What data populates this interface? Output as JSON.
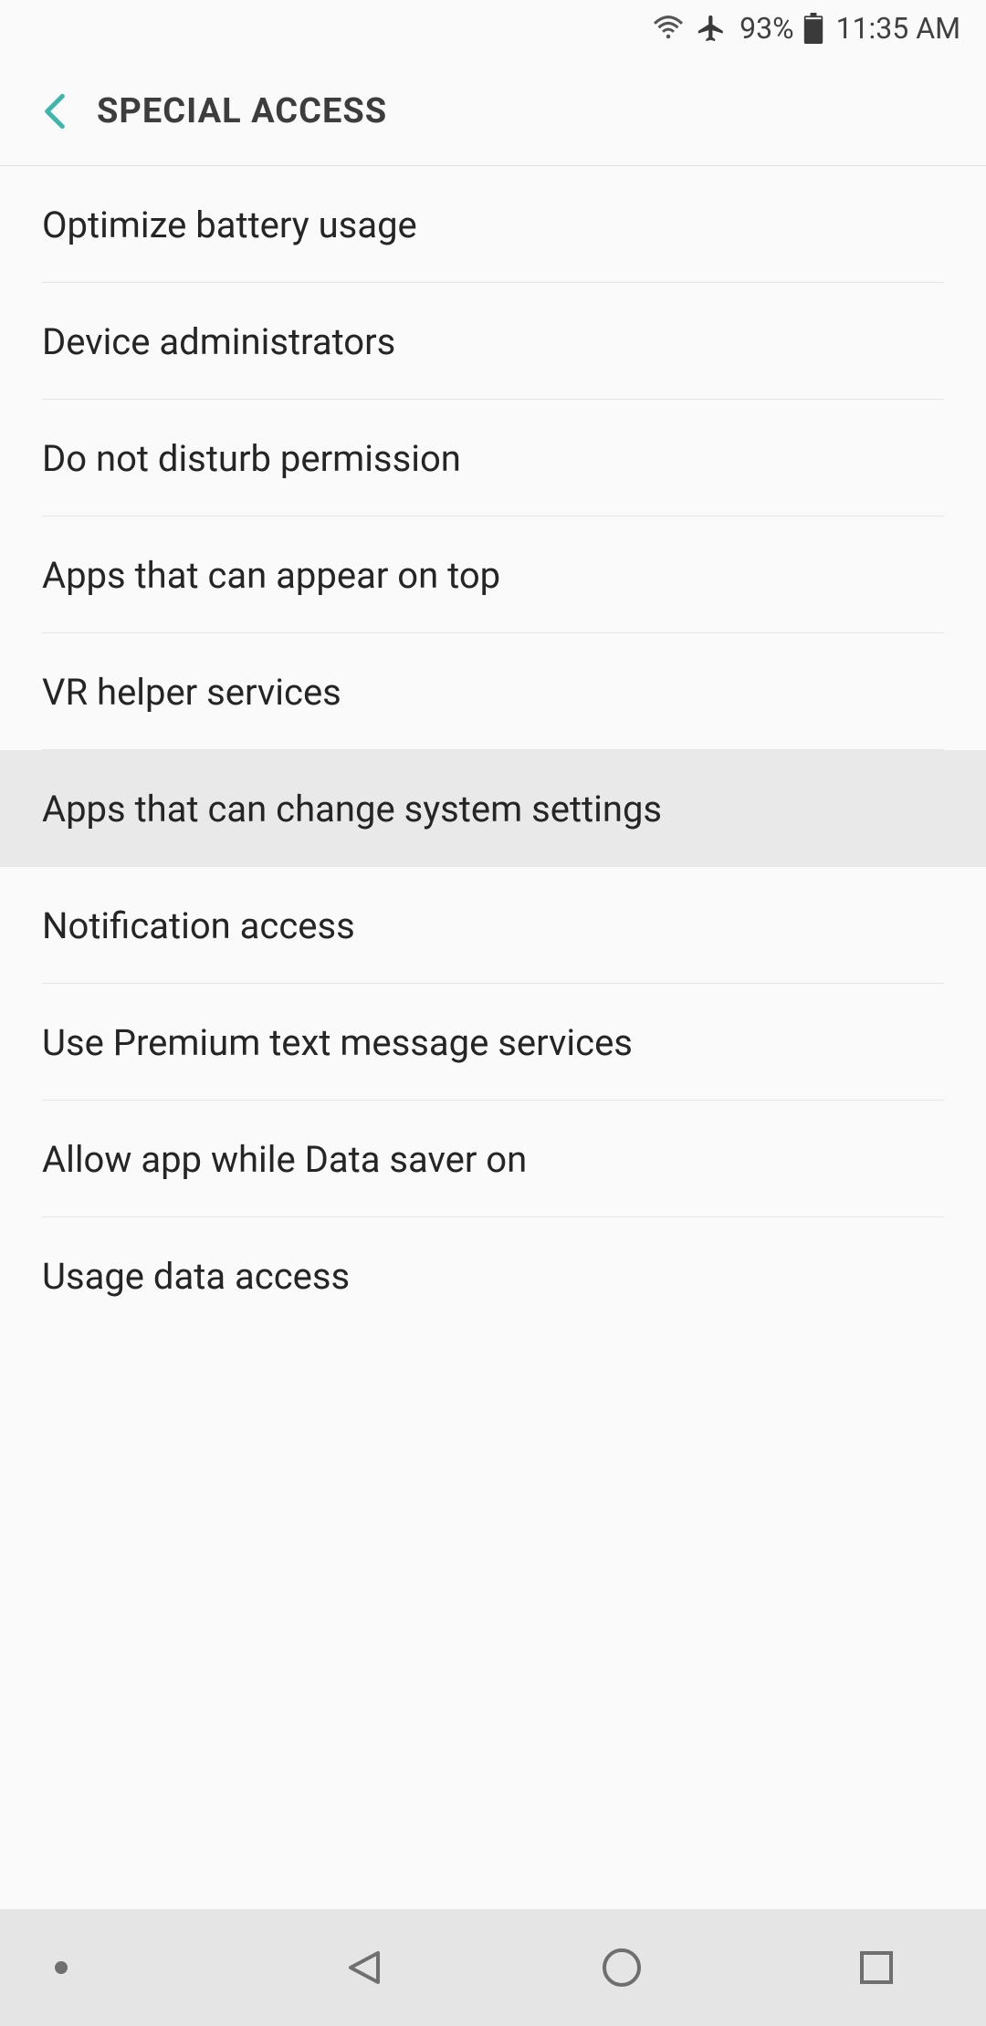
{
  "status_bar": {
    "battery_percent": "93%",
    "time": "11:35 AM"
  },
  "app_bar": {
    "title": "SPECIAL ACCESS"
  },
  "list": {
    "items": [
      {
        "label": "Optimize battery usage",
        "highlighted": false
      },
      {
        "label": "Device administrators",
        "highlighted": false
      },
      {
        "label": "Do not disturb permission",
        "highlighted": false
      },
      {
        "label": "Apps that can appear on top",
        "highlighted": false
      },
      {
        "label": "VR helper services",
        "highlighted": false
      },
      {
        "label": "Apps that can change system settings",
        "highlighted": true
      },
      {
        "label": "Notification access",
        "highlighted": false
      },
      {
        "label": "Use Premium text message services",
        "highlighted": false
      },
      {
        "label": "Allow app while Data saver on",
        "highlighted": false
      },
      {
        "label": "Usage data access",
        "highlighted": false
      }
    ]
  }
}
